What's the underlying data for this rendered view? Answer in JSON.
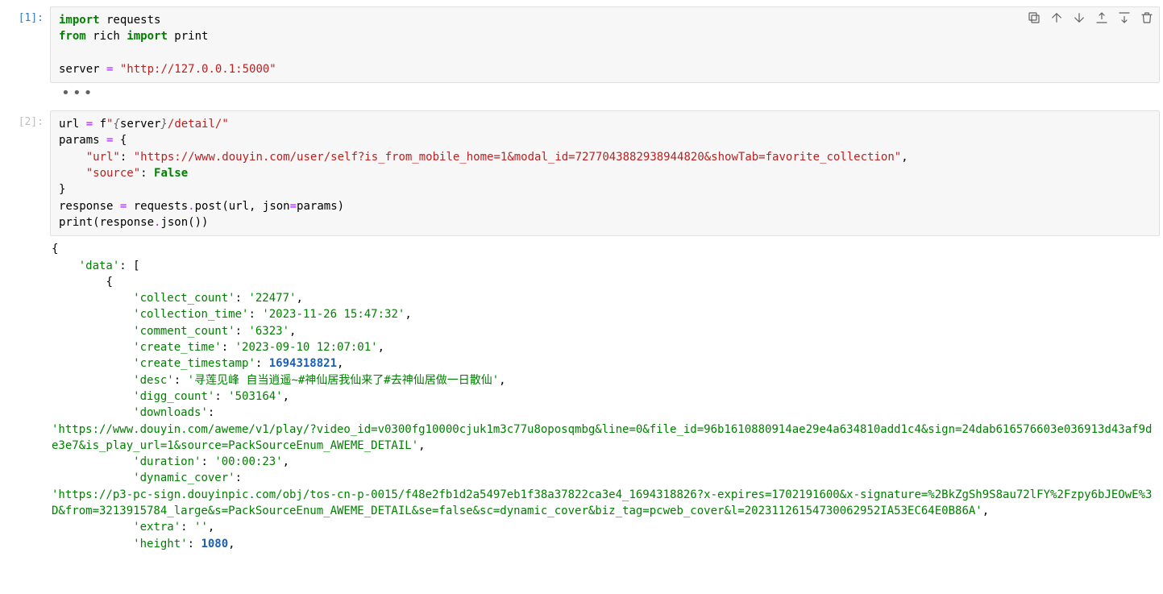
{
  "cells": {
    "0": {
      "prompt": "[1]:",
      "code": {
        "l0_kw1": "import",
        "l0_mod": " requests",
        "l1_kw1": "from",
        "l1_mod": " rich ",
        "l1_kw2": "import",
        "l1_name": " print",
        "l3_lhs": "server ",
        "l3_eq": "= ",
        "l3_str": "\"http://127.0.0.1:5000\""
      }
    },
    "1": {
      "prompt": "[2]:",
      "code": {
        "l0": "url = f\"",
        "l0_brace_open": "{",
        "l0_srv": "server",
        "l0_brace_close": "}",
        "l0_tail": "/detail/\"",
        "l1_lhs": "params ",
        "l1_eq": "= ",
        "l1_brace": "{",
        "l2_indent": "    ",
        "l2_key": "\"url\"",
        "l2_sep": ": ",
        "l2_val": "\"https://www.douyin.com/user/self?is_from_mobile_home=1&modal_id=7277043882938944820&showTab=favorite_collection\"",
        "l2_comma": ",",
        "l3_indent": "    ",
        "l3_key": "\"source\"",
        "l3_sep": ": ",
        "l3_val": "False",
        "l4_brace": "}",
        "l5_a": "response ",
        "l5_eq": "= ",
        "l5_req": "requests",
        "l5_dot": ".",
        "l5_post": "post",
        "l5_args": "(url, json",
        "l5_eq2": "=",
        "l5_p": "params)",
        "l6_a": "print",
        "l6_b": "(response",
        "l6_c": ".",
        "l6_d": "json",
        "l6_e": "())"
      }
    }
  },
  "ellipsis": "•••",
  "toolbar_icons": {
    "copy": "copy-icon",
    "up": "arrow-up-icon",
    "down": "arrow-down-icon",
    "insert_above": "insert-above-icon",
    "insert_below": "insert-below-icon",
    "delete": "delete-icon"
  },
  "output": {
    "open_brace": "{",
    "data_key": "'data'",
    "bracket_open": "[",
    "inner_brace": "{",
    "pairs": {
      "collect_count_k": "'collect_count'",
      "collect_count_v": "'22477'",
      "collection_time_k": "'collection_time'",
      "collection_time_v": "'2023-11-26 15:47:32'",
      "comment_count_k": "'comment_count'",
      "comment_count_v": "'6323'",
      "create_time_k": "'create_time'",
      "create_time_v": "'2023-09-10 12:07:01'",
      "create_timestamp_k": "'create_timestamp'",
      "create_timestamp_v": "1694318821",
      "desc_k": "'desc'",
      "desc_v": "'寻莲见峰 自当逍遥~#神仙居我仙来了#去神仙居做一日散仙'",
      "digg_count_k": "'digg_count'",
      "digg_count_v": "'503164'",
      "downloads_k": "'downloads'",
      "downloads_v": "'https://www.douyin.com/aweme/v1/play/?video_id=v0300fg10000cjuk1m3c77u8oposqmbg&line=0&file_id=96b1610880914ae29e4a634810add1c4&sign=24dab616576603e036913d43af9de3e7&is_play_url=1&source=PackSourceEnum_AWEME_DETAIL'",
      "duration_k": "'duration'",
      "duration_v": "'00:00:23'",
      "dynamic_cover_k": "'dynamic_cover'",
      "dynamic_cover_v": "'https://p3-pc-sign.douyinpic.com/obj/tos-cn-p-0015/f48e2fb1d2a5497eb1f38a37822ca3e4_1694318826?x-expires=1702191600&x-signature=%2BkZgSh9S8au72lFY%2Fzpy6bJEOwE%3D&from=3213915784_large&s=PackSourceEnum_AWEME_DETAIL&se=false&sc=dynamic_cover&biz_tag=pcweb_cover&l=20231126154730062952IA53EC64E0B86A'",
      "extra_k": "'extra'",
      "extra_v": "''",
      "height_k": "'height'",
      "height_v": "1080"
    }
  }
}
